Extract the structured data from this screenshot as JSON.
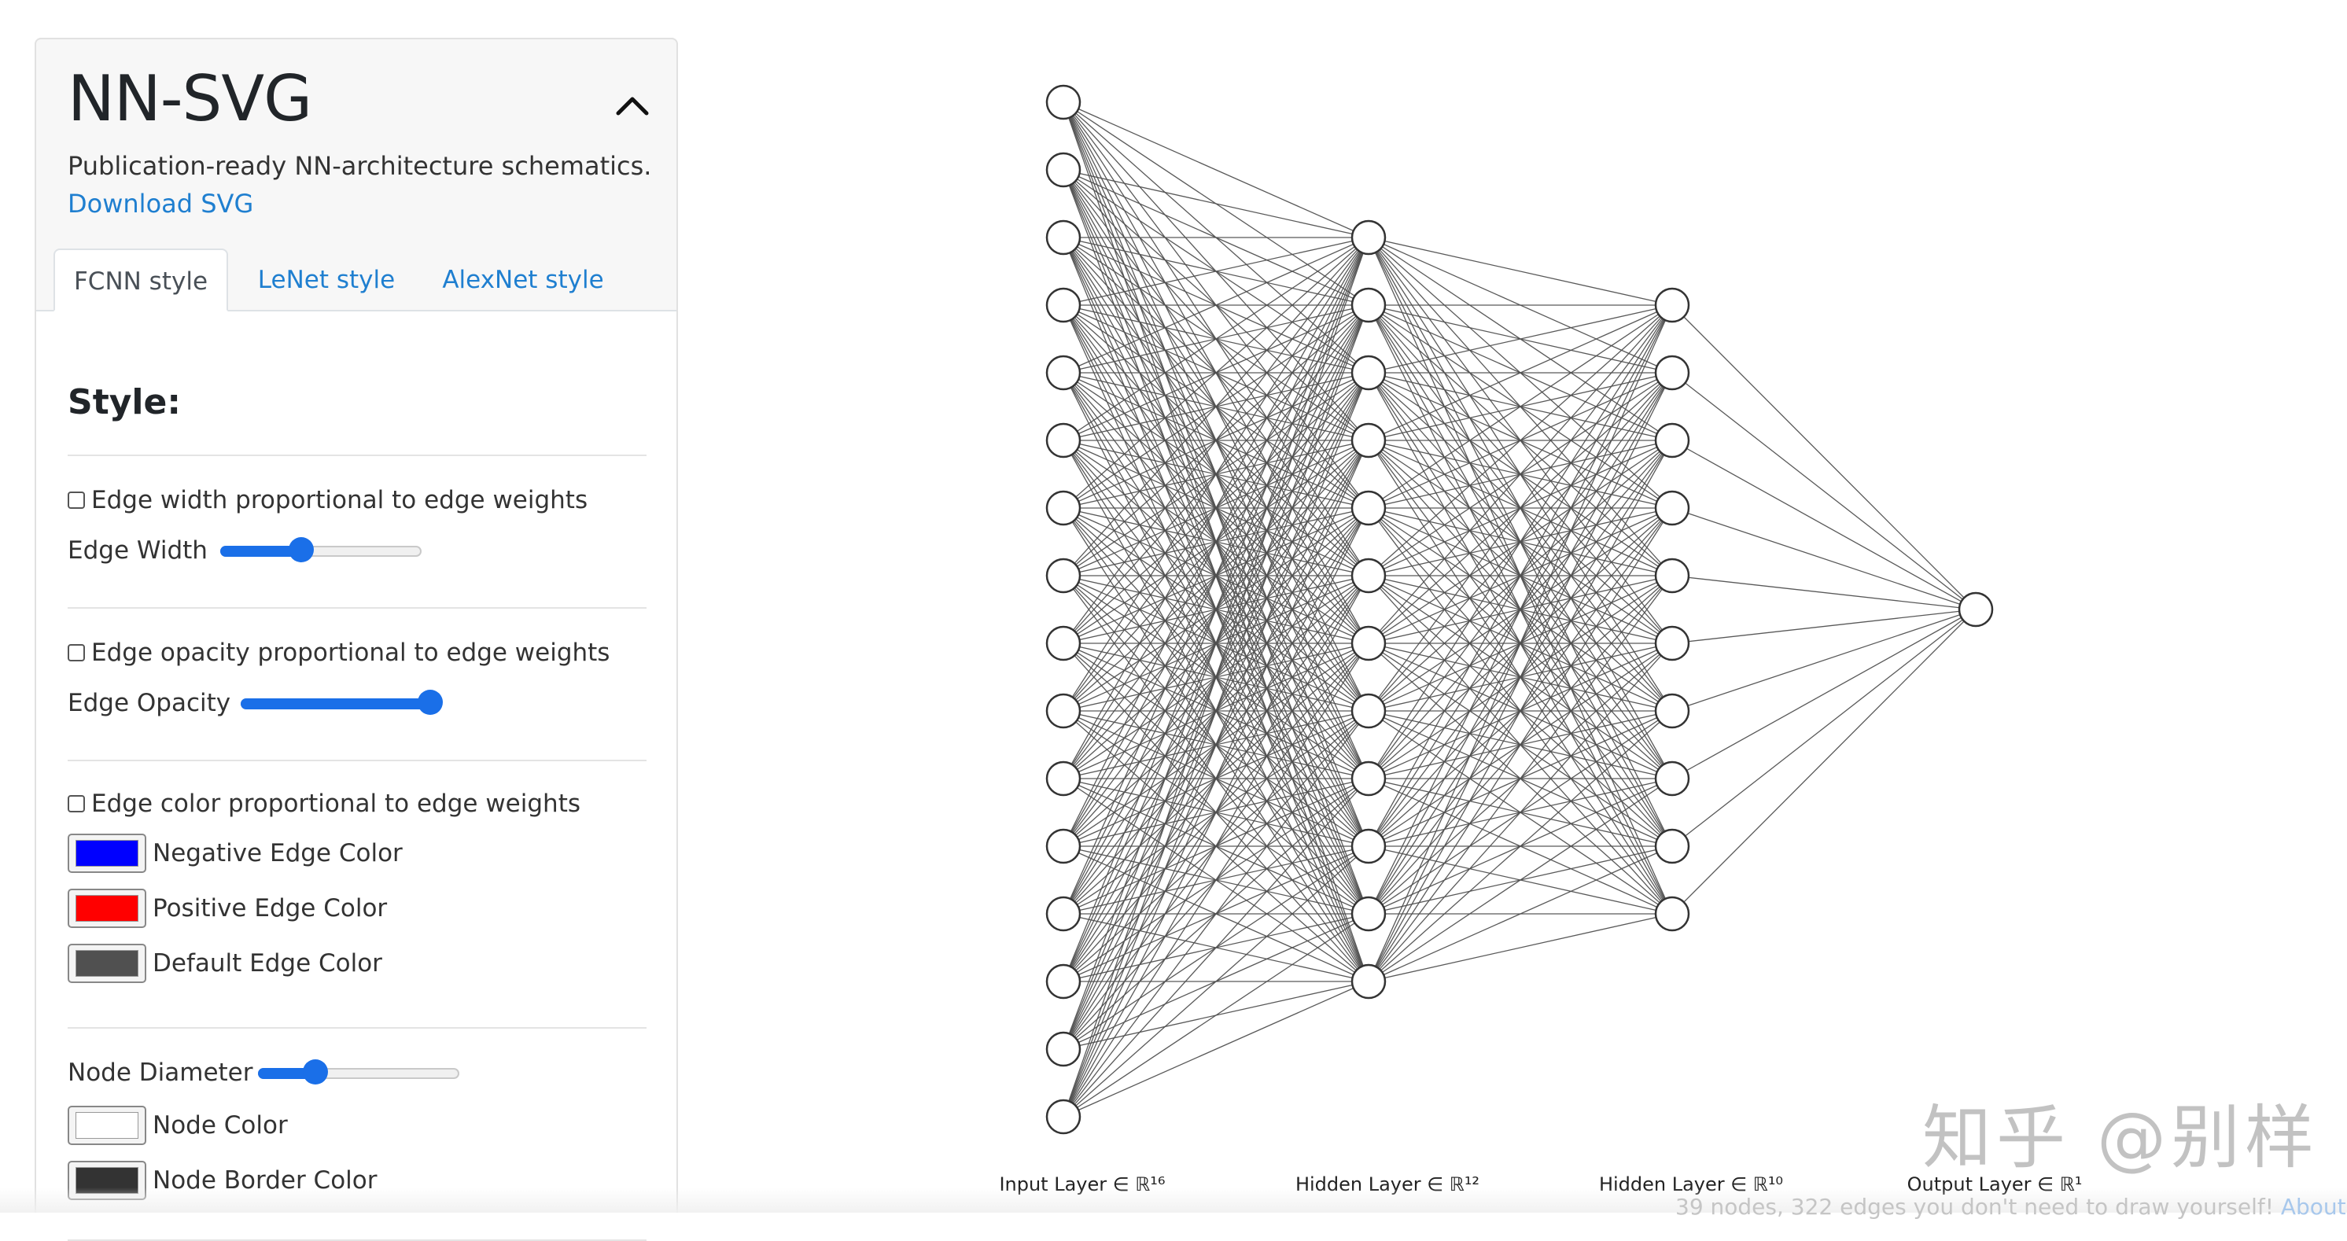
{
  "app": {
    "title": "NN-SVG",
    "subtitle": "Publication-ready NN-architecture schematics.",
    "download_label": "Download SVG"
  },
  "tabs": [
    {
      "label": "FCNN style",
      "active": true
    },
    {
      "label": "LeNet style",
      "active": false
    },
    {
      "label": "AlexNet style",
      "active": false
    }
  ],
  "style_panel": {
    "heading": "Style:",
    "edge_width_check": {
      "label": "Edge width proportional to edge weights",
      "checked": false
    },
    "edge_width": {
      "label": "Edge Width",
      "value": 0.4
    },
    "edge_opacity_check": {
      "label": "Edge opacity proportional to edge weights",
      "checked": false
    },
    "edge_opacity": {
      "label": "Edge Opacity",
      "value": 0.95
    },
    "edge_color_check": {
      "label": "Edge color proportional to edge weights",
      "checked": false
    },
    "negative_color": {
      "label": "Negative Edge Color",
      "color": "#0000ff"
    },
    "positive_color": {
      "label": "Positive Edge Color",
      "color": "#ff0000"
    },
    "default_color": {
      "label": "Default Edge Color",
      "color": "#505050"
    },
    "node_diameter": {
      "label": "Node Diameter",
      "value": 0.28
    },
    "node_color": {
      "label": "Node Color",
      "color": "#ffffff"
    },
    "node_border_color": {
      "label": "Node Border Color",
      "color": "#333333"
    }
  },
  "network": {
    "layer_sizes": [
      16,
      12,
      10,
      1
    ],
    "layers": [
      {
        "label": "Input Layer ∈ ℝ¹⁶"
      },
      {
        "label": "Hidden Layer ∈ ℝ¹²"
      },
      {
        "label": "Hidden Layer ∈ ℝ¹⁰"
      },
      {
        "label": "Output Layer ∈ ℝ¹"
      }
    ]
  },
  "watermark": "知乎 @别样",
  "footer": {
    "text": "39 nodes, 322 edges you don't need to draw yourself! ",
    "link": "About"
  }
}
